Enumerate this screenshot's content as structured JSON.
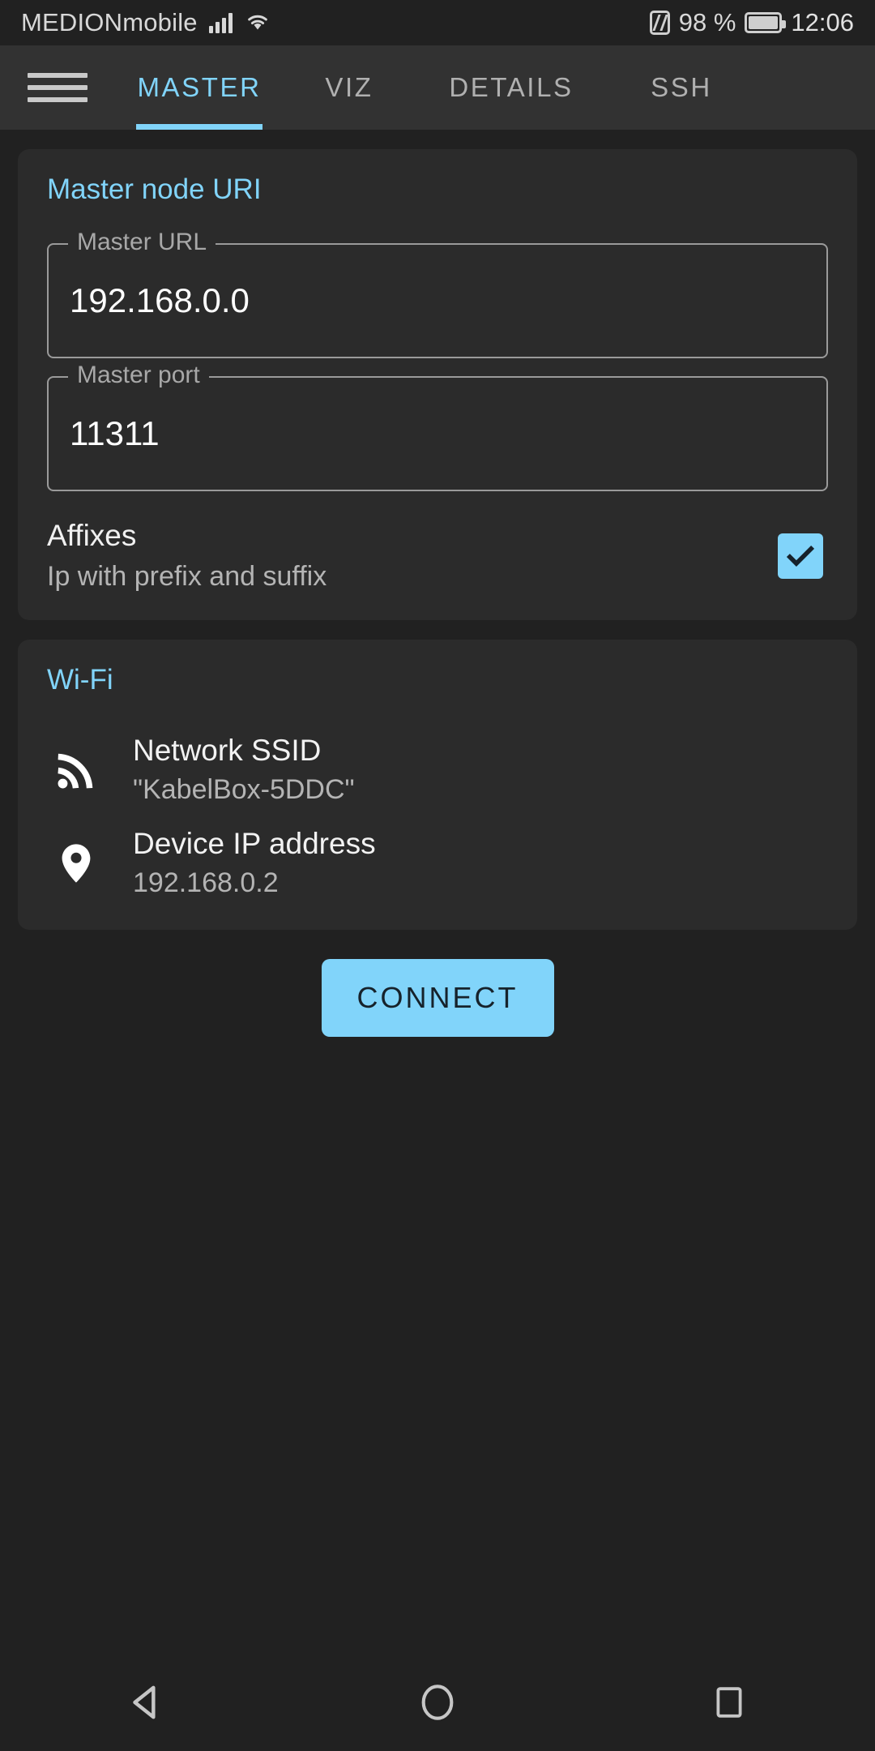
{
  "statusbar": {
    "carrier": "MEDIONmobile",
    "signal_icon": "cellular-signal-icon",
    "wifi_icon": "wifi-icon",
    "nfc_icon": "nfc-icon",
    "battery_percent": "98 %",
    "battery_icon": "battery-full-icon",
    "clock": "12:06"
  },
  "appbar": {
    "menu_icon": "hamburger-menu-icon",
    "tabs": [
      {
        "label": "MASTER",
        "active": true
      },
      {
        "label": "VIZ",
        "active": false
      },
      {
        "label": "DETAILS",
        "active": false
      },
      {
        "label": "SSH",
        "active": false
      }
    ]
  },
  "master_card": {
    "title": "Master node URI",
    "fields": [
      {
        "label": "Master URL",
        "value": "192.168.0.0",
        "placeholder": "Master URL"
      },
      {
        "label": "Master port",
        "value": "11311",
        "placeholder": "Master port"
      }
    ],
    "affixes": {
      "primary": "Affixes",
      "secondary": "Ip with prefix and suffix",
      "checked": true
    }
  },
  "wifi_card": {
    "title": "Wi-Fi",
    "rows": [
      {
        "icon": "rss-signal-icon",
        "primary": "Network SSID",
        "secondary": "\"KabelBox-5DDC\""
      },
      {
        "icon": "location-pin-icon",
        "primary": "Device IP address",
        "secondary": "192.168.0.2"
      }
    ]
  },
  "actions": {
    "connect_label": "CONNECT"
  },
  "navbar": {
    "back_icon": "back-triangle-icon",
    "home_icon": "home-circle-icon",
    "recents_icon": "recents-square-icon"
  },
  "colors": {
    "accent": "#81d4fa",
    "background": "#212121",
    "card": "#2b2b2b",
    "appbar": "#323232",
    "text_primary": "#ffffff",
    "text_secondary": "#b4b4b4"
  }
}
